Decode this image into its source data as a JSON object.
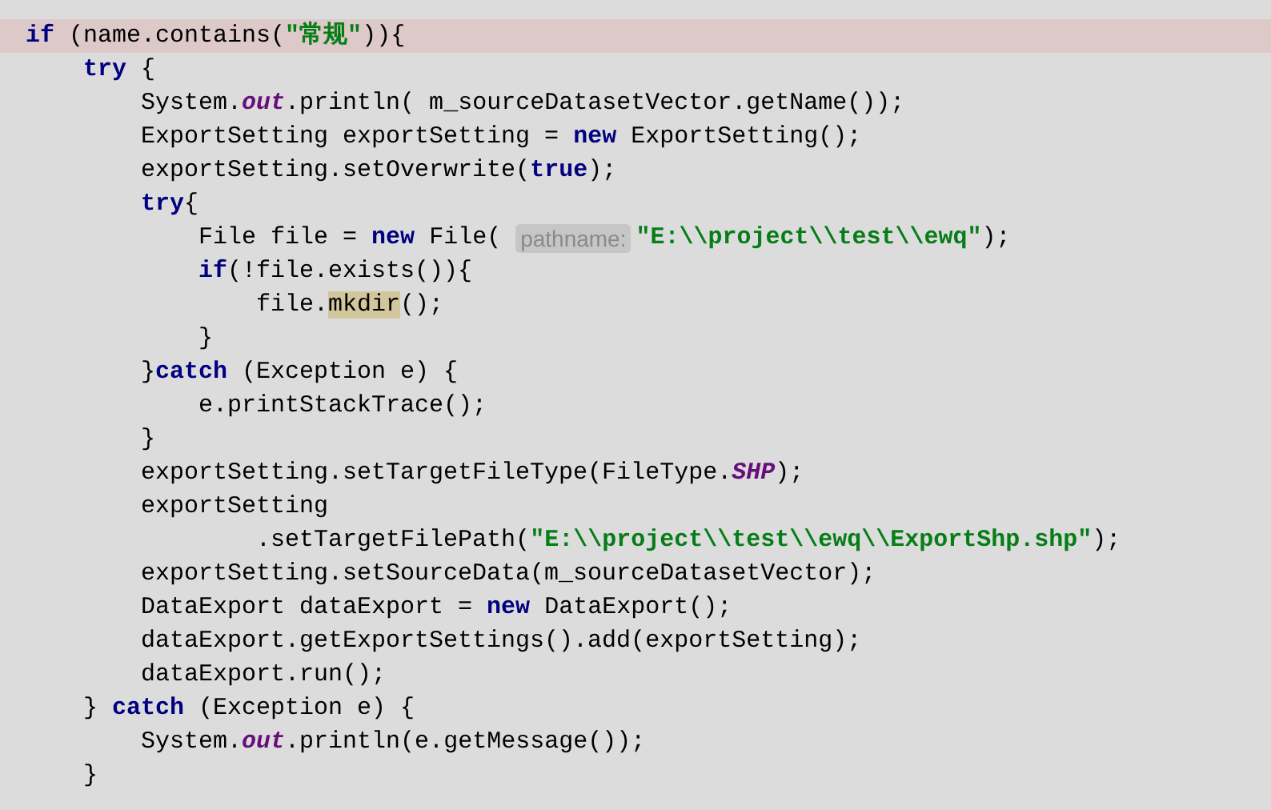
{
  "editor": {
    "lines": [
      {
        "current": true,
        "tokens": [
          {
            "kind": "keyword",
            "text": "if"
          },
          {
            "kind": "plain",
            "text": " (name.contains("
          },
          {
            "kind": "string",
            "text": "\"常规\""
          },
          {
            "kind": "plain",
            "text": ")){"
          }
        ]
      },
      {
        "current": false,
        "tokens": [
          {
            "kind": "keyword",
            "text": "    try"
          },
          {
            "kind": "plain",
            "text": " {"
          }
        ]
      },
      {
        "current": false,
        "tokens": [
          {
            "kind": "plain",
            "text": "        System."
          },
          {
            "kind": "static",
            "text": "out"
          },
          {
            "kind": "plain",
            "text": ".println( m_sourceDatasetVector.getName());"
          }
        ]
      },
      {
        "current": false,
        "tokens": [
          {
            "kind": "plain",
            "text": "        ExportSetting exportSetting = "
          },
          {
            "kind": "keyword",
            "text": "new"
          },
          {
            "kind": "plain",
            "text": " ExportSetting();"
          }
        ]
      },
      {
        "current": false,
        "tokens": [
          {
            "kind": "plain",
            "text": "        exportSetting.setOverwrite("
          },
          {
            "kind": "keyword",
            "text": "true"
          },
          {
            "kind": "plain",
            "text": ");"
          }
        ]
      },
      {
        "current": false,
        "tokens": [
          {
            "kind": "keyword",
            "text": "        try"
          },
          {
            "kind": "plain",
            "text": "{"
          }
        ]
      },
      {
        "current": false,
        "tokens": [
          {
            "kind": "plain",
            "text": "            File file = "
          },
          {
            "kind": "keyword",
            "text": "new"
          },
          {
            "kind": "plain",
            "text": " File( "
          },
          {
            "kind": "hint",
            "text": "pathname:"
          },
          {
            "kind": "string",
            "text": "\"E:\\\\project\\\\test\\\\ewq\""
          },
          {
            "kind": "plain",
            "text": ");"
          }
        ]
      },
      {
        "current": false,
        "tokens": [
          {
            "kind": "keyword",
            "text": "            if"
          },
          {
            "kind": "plain",
            "text": "(!file.exists()){"
          }
        ]
      },
      {
        "current": false,
        "tokens": [
          {
            "kind": "plain",
            "text": "                file."
          },
          {
            "kind": "match",
            "text": "mkdir"
          },
          {
            "kind": "plain",
            "text": "();"
          }
        ]
      },
      {
        "current": false,
        "tokens": [
          {
            "kind": "plain",
            "text": "            }"
          }
        ]
      },
      {
        "current": false,
        "tokens": [
          {
            "kind": "plain",
            "text": "        }"
          },
          {
            "kind": "keyword",
            "text": "catch"
          },
          {
            "kind": "plain",
            "text": " (Exception e) {"
          }
        ]
      },
      {
        "current": false,
        "tokens": [
          {
            "kind": "plain",
            "text": "            e.printStackTrace();"
          }
        ]
      },
      {
        "current": false,
        "tokens": [
          {
            "kind": "plain",
            "text": "        }"
          }
        ]
      },
      {
        "current": false,
        "tokens": [
          {
            "kind": "plain",
            "text": "        exportSetting.setTargetFileType(FileType."
          },
          {
            "kind": "static",
            "text": "SHP"
          },
          {
            "kind": "plain",
            "text": ");"
          }
        ]
      },
      {
        "current": false,
        "tokens": [
          {
            "kind": "plain",
            "text": "        exportSetting"
          }
        ]
      },
      {
        "current": false,
        "tokens": [
          {
            "kind": "plain",
            "text": "                .setTargetFilePath("
          },
          {
            "kind": "string",
            "text": "\"E:\\\\project\\\\test\\\\ewq\\\\ExportShp.shp\""
          },
          {
            "kind": "plain",
            "text": ");"
          }
        ]
      },
      {
        "current": false,
        "tokens": [
          {
            "kind": "plain",
            "text": "        exportSetting.setSourceData(m_sourceDatasetVector);"
          }
        ]
      },
      {
        "current": false,
        "tokens": [
          {
            "kind": "plain",
            "text": "        DataExport dataExport = "
          },
          {
            "kind": "keyword",
            "text": "new"
          },
          {
            "kind": "plain",
            "text": " DataExport();"
          }
        ]
      },
      {
        "current": false,
        "tokens": [
          {
            "kind": "plain",
            "text": "        dataExport.getExportSettings().add(exportSetting);"
          }
        ]
      },
      {
        "current": false,
        "tokens": [
          {
            "kind": "plain",
            "text": "        dataExport.run();"
          }
        ]
      },
      {
        "current": false,
        "tokens": [
          {
            "kind": "plain",
            "text": "    } "
          },
          {
            "kind": "keyword",
            "text": "catch"
          },
          {
            "kind": "plain",
            "text": " (Exception e) {"
          }
        ]
      },
      {
        "current": false,
        "tokens": [
          {
            "kind": "plain",
            "text": "        System."
          },
          {
            "kind": "static",
            "text": "out"
          },
          {
            "kind": "plain",
            "text": ".println(e.getMessage());"
          }
        ]
      },
      {
        "current": false,
        "tokens": [
          {
            "kind": "plain",
            "text": "    }"
          }
        ]
      }
    ]
  }
}
